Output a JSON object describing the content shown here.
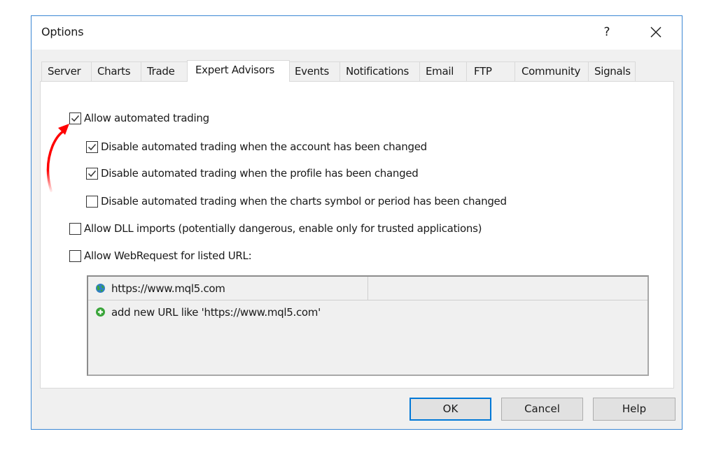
{
  "window": {
    "title": "Options",
    "help_label": "?",
    "close_icon": "close-icon"
  },
  "tabs": [
    {
      "label": "Server",
      "active": false
    },
    {
      "label": "Charts",
      "active": false
    },
    {
      "label": "Trade",
      "active": false
    },
    {
      "label": "Expert Advisors",
      "active": true
    },
    {
      "label": "Events",
      "active": false
    },
    {
      "label": "Notifications",
      "active": false
    },
    {
      "label": "Email",
      "active": false
    },
    {
      "label": "FTP",
      "active": false
    },
    {
      "label": "Community",
      "active": false
    },
    {
      "label": "Signals",
      "active": false
    }
  ],
  "expert_advisors": {
    "allow_automated_trading": {
      "label": "Allow automated trading",
      "checked": true
    },
    "disable_on_account_change": {
      "label": "Disable automated trading when the account has been changed",
      "checked": true
    },
    "disable_on_profile_change": {
      "label": "Disable automated trading when the profile has been changed",
      "checked": true
    },
    "disable_on_symbol_change": {
      "label": "Disable automated trading when the charts symbol or period has been changed",
      "checked": false
    },
    "allow_dll_imports": {
      "label": "Allow DLL imports (potentially dangerous, enable only for trusted applications)",
      "checked": false
    },
    "allow_webrequest": {
      "label": "Allow WebRequest for listed URL:",
      "checked": false
    },
    "url_list": {
      "items": [
        {
          "url": "https://www.mql5.com",
          "icon": "globe-icon"
        }
      ],
      "add_new_label": "add new URL like 'https://www.mql5.com'",
      "add_icon": "add-circle-icon"
    },
    "annotation": {
      "icon": "red-curved-arrow-icon",
      "color": "#ff0000"
    }
  },
  "buttons": {
    "ok": "OK",
    "cancel": "Cancel",
    "help": "Help"
  },
  "colors": {
    "accent": "#0078d7",
    "window_border": "#3b87d4",
    "dialog_bg": "#f0f0f0"
  }
}
